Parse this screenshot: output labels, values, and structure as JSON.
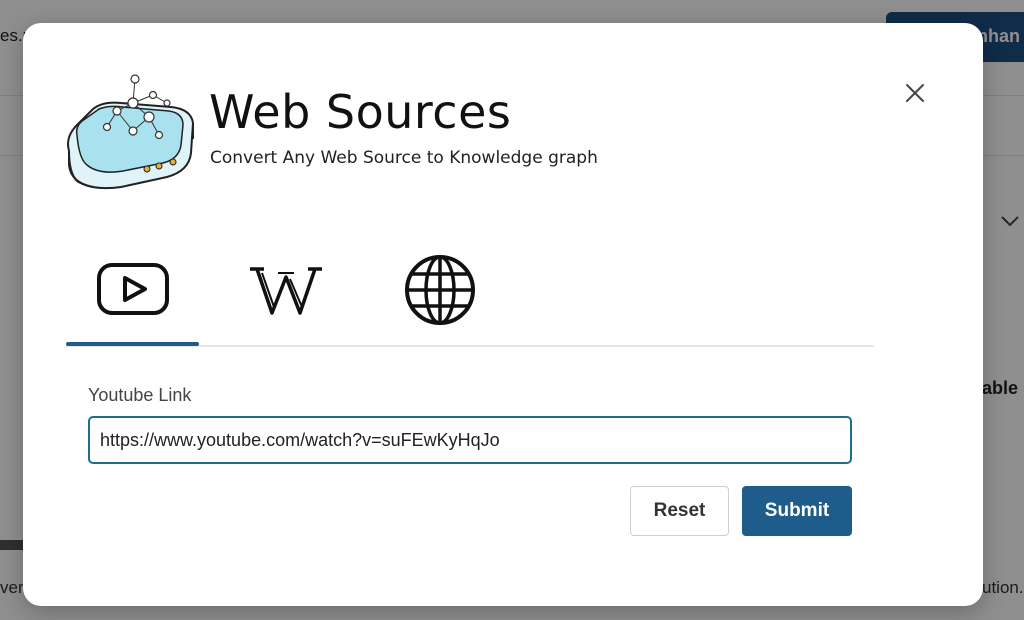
{
  "background": {
    "top_left_text": "es.n",
    "primary_button_label": "nhan",
    "side_text": "able",
    "bottom_left_text": "ver",
    "bottom_right_text": "ution."
  },
  "modal": {
    "title": "Web Sources",
    "subtitle": "Convert Any Web Source to Knowledge graph",
    "close_label": "Close",
    "tabs": [
      {
        "id": "youtube",
        "label": "YouTube",
        "icon": "youtube-icon",
        "selected": true
      },
      {
        "id": "wikipedia",
        "label": "Wikipedia",
        "icon": "wikipedia-icon",
        "selected": false
      },
      {
        "id": "web",
        "label": "Web",
        "icon": "globe-icon",
        "selected": false
      }
    ],
    "form": {
      "label": "Youtube Link",
      "value": "https://www.youtube.com/watch?v=suFEwKyHqJo",
      "reset_label": "Reset",
      "submit_label": "Submit"
    }
  },
  "colors": {
    "accent": "#1d5c8b",
    "input_border": "#1d6e8c",
    "backdrop": "rgba(0,0,0,0.44)"
  }
}
